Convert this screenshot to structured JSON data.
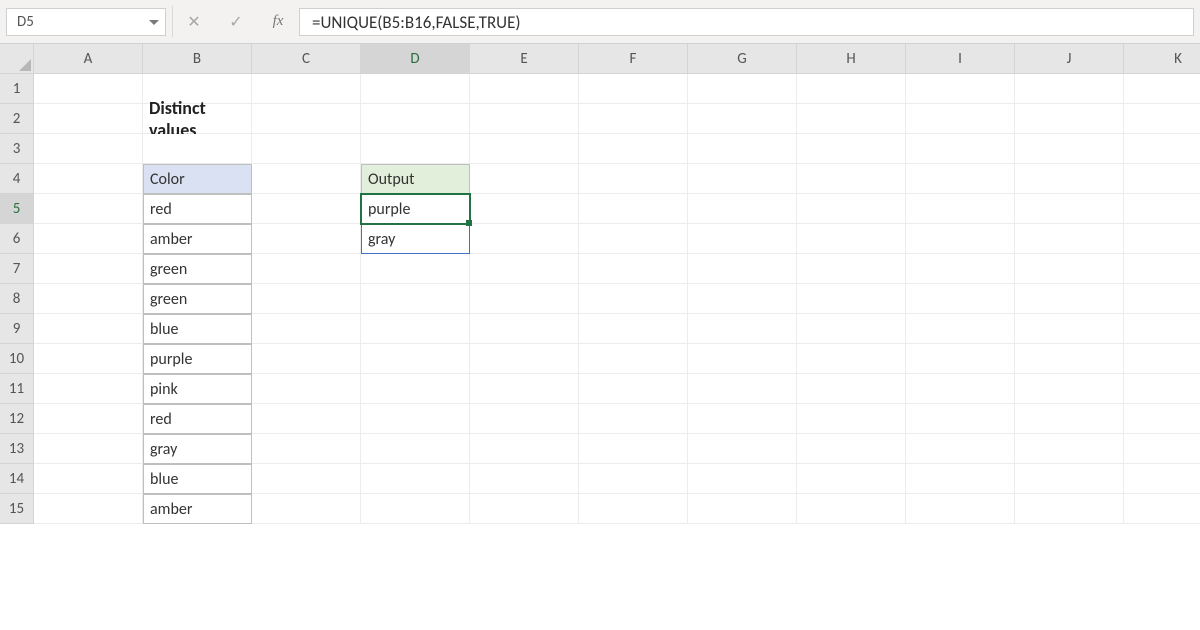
{
  "nameBox": {
    "value": "D5"
  },
  "formulaBar": {
    "cancelGlyph": "✕",
    "enterGlyph": "✓",
    "fxLabel": "fx",
    "formula": "=UNIQUE(B5:B16,FALSE,TRUE)"
  },
  "columns": [
    "A",
    "B",
    "C",
    "D",
    "E",
    "F",
    "G",
    "H",
    "I",
    "J",
    "K"
  ],
  "rows": [
    "1",
    "2",
    "3",
    "4",
    "5",
    "6",
    "7",
    "8",
    "9",
    "10",
    "11",
    "12",
    "13",
    "14",
    "15"
  ],
  "activeCol": "D",
  "activeRow": "5",
  "cells": {
    "B2": {
      "text": "Distinct values",
      "cls": "bold"
    },
    "B4": {
      "text": "Color",
      "cls": "th-blue"
    },
    "B5": {
      "text": "red",
      "cls": "td-border"
    },
    "B6": {
      "text": "amber",
      "cls": "td-border"
    },
    "B7": {
      "text": "green",
      "cls": "td-border"
    },
    "B8": {
      "text": "green",
      "cls": "td-border"
    },
    "B9": {
      "text": "blue",
      "cls": "td-border"
    },
    "B10": {
      "text": "purple",
      "cls": "td-border"
    },
    "B11": {
      "text": "pink",
      "cls": "td-border"
    },
    "B12": {
      "text": "red",
      "cls": "td-border"
    },
    "B13": {
      "text": "gray",
      "cls": "td-border"
    },
    "B14": {
      "text": "blue",
      "cls": "td-border"
    },
    "B15": {
      "text": "amber",
      "cls": "td-border"
    },
    "D4": {
      "text": "Output",
      "cls": "th-green"
    },
    "D5": {
      "text": "purple",
      "cls": "td-border active-cell"
    },
    "D6": {
      "text": "gray",
      "cls": "td-border spill-cell"
    }
  }
}
